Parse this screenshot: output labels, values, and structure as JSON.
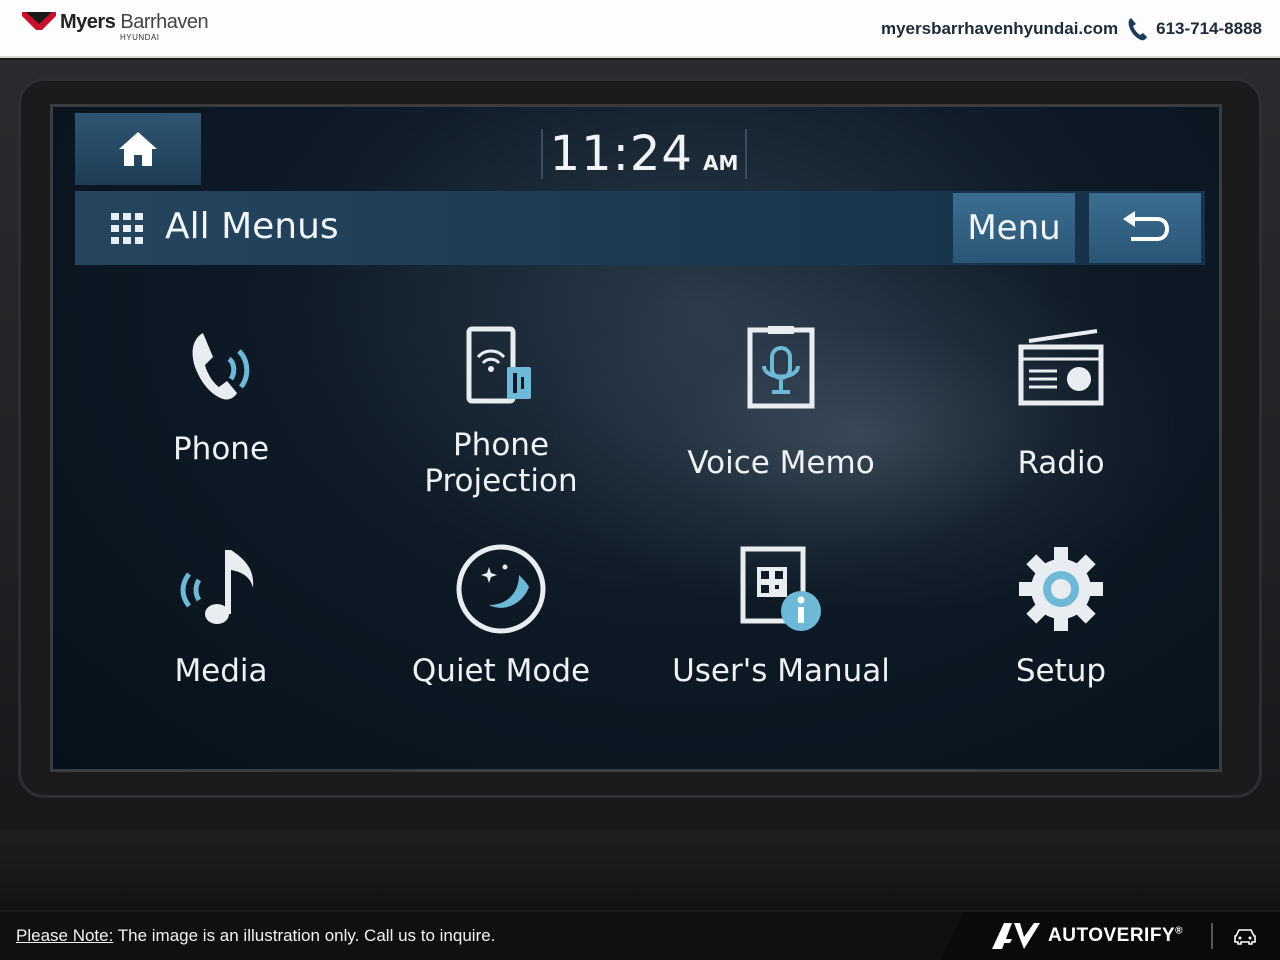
{
  "dealer": {
    "brand_bold": "Myers",
    "brand_light": "Barrhaven",
    "brand_sub": "HYUNDAI",
    "website": "myersbarrhavenhyundai.com",
    "phone": "613-714-8888"
  },
  "screen": {
    "clock_time": "11:24",
    "clock_ampm": "AM",
    "title": "All Menus",
    "menu_label": "Menu",
    "tiles": [
      {
        "label": "Phone",
        "icon": "phone-icon"
      },
      {
        "label": "Phone Projection",
        "icon": "phone-projection-icon"
      },
      {
        "label": "Voice Memo",
        "icon": "voice-memo-icon"
      },
      {
        "label": "Radio",
        "icon": "radio-icon"
      },
      {
        "label": "Media",
        "icon": "media-icon"
      },
      {
        "label": "Quiet Mode",
        "icon": "quiet-mode-icon"
      },
      {
        "label": "User's Manual",
        "icon": "users-manual-icon"
      },
      {
        "label": "Setup",
        "icon": "setup-icon"
      }
    ],
    "accent_color": "#6fb9d8"
  },
  "footer": {
    "note_label": "Please Note:",
    "note_text": " The image is an illustration only. Call us to inquire.",
    "brand": "AUTOVERIFY",
    "brand_mark": "®"
  }
}
